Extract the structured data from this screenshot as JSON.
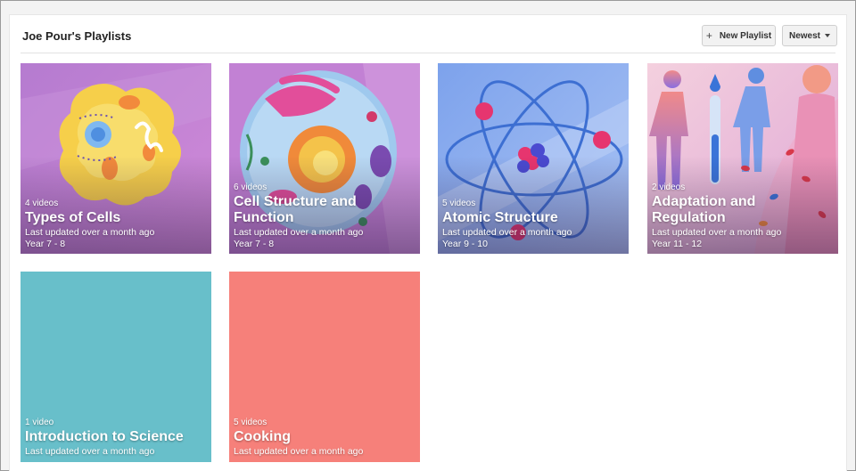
{
  "header": {
    "title": "Joe Pour's Playlists",
    "new_playlist_label": "New Playlist",
    "plus_glyph": "+",
    "sort_label": "Newest"
  },
  "playlists": [
    {
      "count": "4 videos",
      "title": "Types of Cells",
      "updated": "Last updated over a month ago",
      "year": "Year 7 - 8",
      "color": "#c77fd6"
    },
    {
      "count": "6 videos",
      "title": "Cell Structure and Function",
      "updated": "Last updated over a month ago",
      "year": "Year 7 - 8",
      "color": "#c27fd2"
    },
    {
      "count": "5 videos",
      "title": "Atomic Structure",
      "updated": "Last updated over a month ago",
      "year": "Year 9 - 10",
      "color": "#8fb0ee"
    },
    {
      "count": "2 videos",
      "title": "Adaptation and Regulation",
      "updated": "Last updated over a month ago",
      "year": "Year 11 - 12",
      "color": "#e9a9c0"
    },
    {
      "count": "1 video",
      "title": "Introduction to Science",
      "updated": "Last updated over a month ago",
      "color": "#68bfca"
    },
    {
      "count": "5 videos",
      "title": "Cooking",
      "updated": "Last updated over a month ago",
      "color": "#f6807a"
    }
  ]
}
